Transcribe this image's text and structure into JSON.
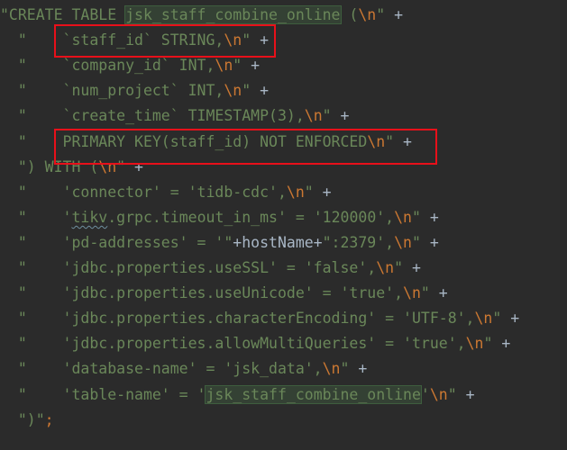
{
  "code_lines": [
    {
      "tokens": [
        {
          "t": "\"CREATE TABLE ",
          "k": "s"
        },
        {
          "t": "jsk_staff_combine_online",
          "k": "s",
          "hl": true
        },
        {
          "t": " (",
          "k": "s"
        },
        {
          "t": "\\n",
          "k": "e"
        },
        {
          "t": "\" ",
          "k": "s"
        },
        {
          "t": "+",
          "k": "p"
        }
      ]
    },
    {
      "tokens": [
        {
          "t": "  \"    `staff_id` STRING,",
          "k": "s"
        },
        {
          "t": "\\n",
          "k": "e"
        },
        {
          "t": "\" ",
          "k": "s"
        },
        {
          "t": "+",
          "k": "p"
        }
      ]
    },
    {
      "tokens": [
        {
          "t": "  \"    `company_id` INT,",
          "k": "s"
        },
        {
          "t": "\\n",
          "k": "e"
        },
        {
          "t": "\" ",
          "k": "s"
        },
        {
          "t": "+",
          "k": "p"
        }
      ]
    },
    {
      "tokens": [
        {
          "t": "  \"    `num_project` INT,",
          "k": "s"
        },
        {
          "t": "\\n",
          "k": "e"
        },
        {
          "t": "\" ",
          "k": "s"
        },
        {
          "t": "+",
          "k": "p"
        }
      ]
    },
    {
      "tokens": [
        {
          "t": "  \"    `create_time` TIMESTAMP(3),",
          "k": "s"
        },
        {
          "t": "\\n",
          "k": "e"
        },
        {
          "t": "\" ",
          "k": "s"
        },
        {
          "t": "+",
          "k": "p"
        }
      ]
    },
    {
      "tokens": [
        {
          "t": "  \"    PRIMARY KEY(staff_id) NOT ENFORCED",
          "k": "s"
        },
        {
          "t": "\\n",
          "k": "e"
        },
        {
          "t": "\" ",
          "k": "s"
        },
        {
          "t": "+",
          "k": "p"
        }
      ]
    },
    {
      "tokens": [
        {
          "t": "  \") WITH (",
          "k": "s"
        },
        {
          "t": "\\n",
          "k": "e"
        },
        {
          "t": "\" ",
          "k": "s"
        },
        {
          "t": "+",
          "k": "p"
        }
      ]
    },
    {
      "tokens": [
        {
          "t": "  \"    'connector' = 'tidb-cdc',",
          "k": "s"
        },
        {
          "t": "\\n",
          "k": "e"
        },
        {
          "t": "\" ",
          "k": "s"
        },
        {
          "t": "+",
          "k": "p"
        }
      ]
    },
    {
      "tokens": [
        {
          "t": "  \"    '",
          "k": "s"
        },
        {
          "t": "tikv",
          "k": "s",
          "sq": true
        },
        {
          "t": ".grpc.timeout_in_ms' = '120000',",
          "k": "s"
        },
        {
          "t": "\\n",
          "k": "e"
        },
        {
          "t": "\" ",
          "k": "s"
        },
        {
          "t": "+",
          "k": "p"
        }
      ]
    },
    {
      "tokens": [
        {
          "t": "  \"    'pd-addresses' = '\"",
          "k": "s"
        },
        {
          "t": "+hostName+",
          "k": "v"
        },
        {
          "t": "\":2379',",
          "k": "s"
        },
        {
          "t": "\\n",
          "k": "e"
        },
        {
          "t": "\" ",
          "k": "s"
        },
        {
          "t": "+",
          "k": "p"
        }
      ]
    },
    {
      "tokens": [
        {
          "t": "  \"    'jdbc.properties.useSSL' = 'false',",
          "k": "s"
        },
        {
          "t": "\\n",
          "k": "e"
        },
        {
          "t": "\" ",
          "k": "s"
        },
        {
          "t": "+",
          "k": "p"
        }
      ]
    },
    {
      "tokens": [
        {
          "t": "  \"    'jdbc.properties.useUnicode' = 'true',",
          "k": "s"
        },
        {
          "t": "\\n",
          "k": "e"
        },
        {
          "t": "\" ",
          "k": "s"
        },
        {
          "t": "+",
          "k": "p"
        }
      ]
    },
    {
      "tokens": [
        {
          "t": "  \"    'jdbc.properties.characterEncoding' = 'UTF-8',",
          "k": "s"
        },
        {
          "t": "\\n",
          "k": "e"
        },
        {
          "t": "\" ",
          "k": "s"
        },
        {
          "t": "+",
          "k": "p"
        }
      ]
    },
    {
      "tokens": [
        {
          "t": "  \"    'jdbc.properties.allowMultiQueries' = 'true',",
          "k": "s"
        },
        {
          "t": "\\n",
          "k": "e"
        },
        {
          "t": "\" ",
          "k": "s"
        },
        {
          "t": "+",
          "k": "p"
        }
      ]
    },
    {
      "tokens": [
        {
          "t": "  \"    'database-name' = 'jsk_data',",
          "k": "s"
        },
        {
          "t": "\\n",
          "k": "e"
        },
        {
          "t": "\" ",
          "k": "s"
        },
        {
          "t": "+",
          "k": "p"
        }
      ]
    },
    {
      "tokens": [
        {
          "t": "  \"    'table-name' = '",
          "k": "s"
        },
        {
          "t": "jsk_staff_combine_online",
          "k": "s",
          "hl": true
        },
        {
          "t": "'",
          "k": "s"
        },
        {
          "t": "\\n",
          "k": "e"
        },
        {
          "t": "\" ",
          "k": "s"
        },
        {
          "t": "+",
          "k": "p"
        }
      ]
    },
    {
      "tokens": [
        {
          "t": "  \")\"",
          "k": "s"
        },
        {
          "t": ";",
          "k": "e"
        }
      ]
    }
  ],
  "colors": {
    "background": "#2b2b2b",
    "string": "#6a8759",
    "escape": "#cc7832",
    "plain": "#a9b7c6",
    "highlight": "#344134",
    "annotation_box": "#e8101a"
  }
}
